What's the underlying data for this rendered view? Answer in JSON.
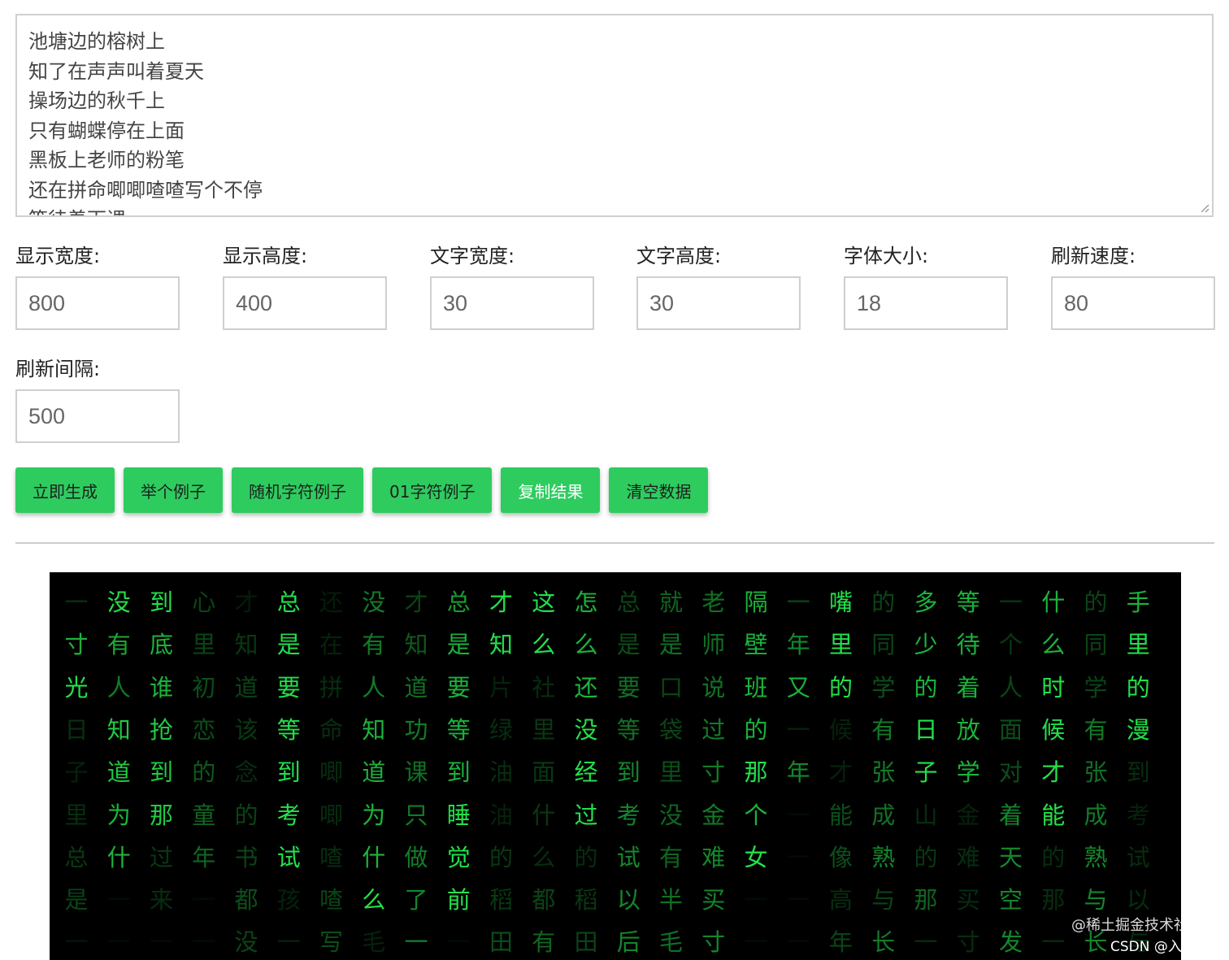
{
  "input": {
    "text": "池塘边的榕树上\n知了在声声叫着夏天\n操场边的秋千上\n只有蝴蝶停在上面\n黑板上老师的粉笔\n还在拼命唧唧喳喳写个不停\n等待着下课"
  },
  "fields": [
    {
      "label": "显示宽度:",
      "value": "800"
    },
    {
      "label": "显示高度:",
      "value": "400"
    },
    {
      "label": "文字宽度:",
      "value": "30"
    },
    {
      "label": "文字高度:",
      "value": "30"
    },
    {
      "label": "字体大小:",
      "value": "18"
    },
    {
      "label": "刷新速度:",
      "value": "80"
    },
    {
      "label": "刷新间隔:",
      "value": "500"
    }
  ],
  "buttons": {
    "generate": "立即生成",
    "example": "举个例子",
    "random_example": "随机字符例子",
    "binary_example": "01字符例子",
    "copy_result": "复制结果",
    "clear_data": "清空数据"
  },
  "colors": {
    "button_green": "#2ecc5f",
    "glyph_green": "#22e04a",
    "canvas_bg": "#000000"
  },
  "matrix": {
    "rows": [
      "一没到心才总还没才总才这怎总就老隔一嘴的多等一什的手",
      "寸有底里知是在有知是知么么是是师壁年里同少待个么同里",
      "光人谁初道要拼人道要片社还要口说班又的学的着人时学的",
      "日知抢恋该等命知功等绿里没等袋过的一候有日放面候有漫",
      "子道到的念到唧道课到油面经到里寸那年才张子学对才张到",
      "里为那童的考唧为只睡油什过考没金个一能成山金着能成考",
      "总什过年书试喳什做觉的么的试有难女一像熟的难天的熟试",
      "是一来一都孩喳么了前稻都稻以半买一一高与那买空那与以",
      "一一一一没一写毛一一田有田后毛寸一一年长一寸发一长与"
    ],
    "brightness": [
      [
        0.22,
        1,
        1,
        0.3,
        0.12,
        1,
        0.12,
        0.55,
        0.3,
        0.7,
        1,
        1,
        0.8,
        0.3,
        0.45,
        0.5,
        0.8,
        0.3,
        1,
        0.3,
        0.8,
        0.8,
        0.25,
        0.8,
        0.3,
        0.8
      ],
      [
        0.8,
        0.75,
        0.8,
        0.3,
        0.25,
        1,
        0.15,
        0.55,
        0.4,
        0.8,
        1,
        1,
        0.8,
        0.35,
        0.5,
        0.5,
        0.8,
        0.6,
        1,
        0.3,
        0.8,
        0.8,
        0.25,
        0.8,
        0.3,
        1
      ],
      [
        1,
        0.55,
        0.8,
        0.35,
        0.3,
        1,
        0.2,
        0.55,
        0.5,
        0.8,
        0.15,
        0.2,
        0.8,
        0.5,
        0.3,
        0.5,
        0.8,
        0.8,
        1,
        0.35,
        0.8,
        0.8,
        0.3,
        1,
        0.3,
        1
      ],
      [
        0.22,
        0.9,
        0.9,
        0.35,
        0.25,
        1,
        0.2,
        0.8,
        0.55,
        0.8,
        0.2,
        0.25,
        1,
        0.5,
        0.3,
        0.55,
        0.8,
        0.15,
        0.15,
        0.55,
        1,
        0.8,
        0.35,
        1,
        0.55,
        1
      ],
      [
        0.15,
        0.9,
        0.9,
        0.4,
        0.2,
        1,
        0.2,
        0.8,
        0.5,
        0.8,
        0.2,
        0.25,
        1,
        0.6,
        0.35,
        0.55,
        1,
        0.6,
        0.15,
        0.55,
        1,
        0.8,
        0.35,
        1,
        0.5,
        0.2
      ],
      [
        0.2,
        0.8,
        0.9,
        0.45,
        0.3,
        1,
        0.2,
        0.8,
        0.55,
        1,
        0.15,
        0.25,
        1,
        0.6,
        0.45,
        0.55,
        0.8,
        0.05,
        0.35,
        0.5,
        0.2,
        0.15,
        0.6,
        1,
        0.55,
        0.15
      ],
      [
        0.25,
        0.8,
        0.25,
        0.45,
        0.3,
        1,
        0.2,
        0.8,
        0.55,
        1,
        0.25,
        0.2,
        0.2,
        0.6,
        0.45,
        0.6,
        1,
        0.05,
        0.35,
        0.6,
        0.25,
        0.2,
        0.6,
        0.2,
        0.6,
        0.2
      ],
      [
        0.3,
        0.05,
        0.2,
        0.05,
        0.35,
        0.15,
        0.3,
        1,
        0.6,
        1,
        0.25,
        0.3,
        0.25,
        0.6,
        0.5,
        0.6,
        0.05,
        0.05,
        0.2,
        0.3,
        0.45,
        0.2,
        0.6,
        0.2,
        0.6,
        0.2
      ],
      [
        0.1,
        0.05,
        0.05,
        0.05,
        0.3,
        0.15,
        0.35,
        0.15,
        0.55,
        0.05,
        0.35,
        0.45,
        0.3,
        0.6,
        0.5,
        0.6,
        0.05,
        0.05,
        0.3,
        0.55,
        0.2,
        0.2,
        0.6,
        0.2,
        0.6,
        0.2
      ]
    ]
  },
  "watermark": {
    "line1": "@稀土掘金技术社区",
    "line2": "CSDN @入门小站"
  }
}
